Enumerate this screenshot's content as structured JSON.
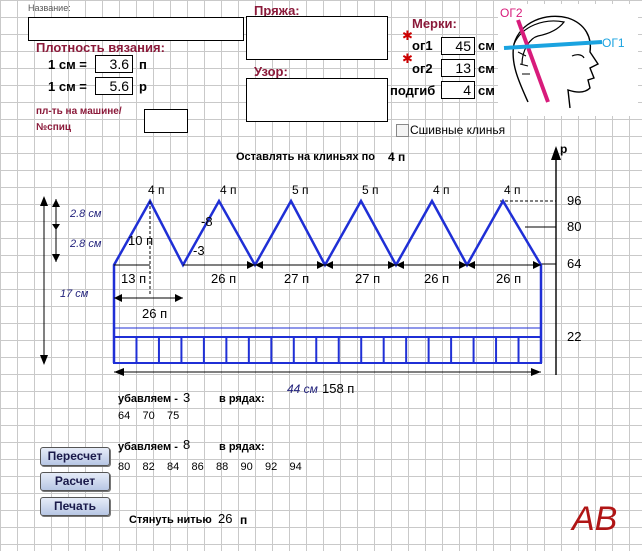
{
  "header": {
    "name_label": "Название:",
    "yarn_label": "Пряжа:",
    "pattern_label": "Узор:",
    "measures_label": "Мерки:"
  },
  "density": {
    "title": "Плотность вязания:",
    "row1_label": "1 см =",
    "row1_value": "3.6",
    "row1_unit": "п",
    "row2_label": "1 см =",
    "row2_value": "5.6",
    "row2_unit": "р",
    "machine_label": "пл-ть на машине/ №спиц"
  },
  "measures": {
    "og1_label": "ог1",
    "og1_value": "45",
    "og1_unit": "см",
    "og2_label": "ог2",
    "og2_value": "13",
    "og2_unit": "см",
    "hem_label": "подгиб",
    "hem_value": "4",
    "hem_unit": "см"
  },
  "head_figure": {
    "og2": "ОГ2",
    "og1": "ОГ1"
  },
  "sewn_wedges": {
    "label": "Сшивные клинья",
    "checked": false
  },
  "leave": {
    "label": "Оставлять на клиньях по",
    "value": "4 п"
  },
  "chart": {
    "top_labels": [
      "4 п",
      "4 п",
      "5 п",
      "5 п",
      "4 п",
      "4 п"
    ],
    "right_labels": [
      "96",
      "80",
      "64",
      "22"
    ],
    "axis_p": "р",
    "left_dims": [
      "2.8 см",
      "2.8 см",
      "17 см"
    ],
    "inner_10": "10 п",
    "minus8": "-8",
    "minus3": "-3",
    "first_13": "13 п",
    "base_26": "26 п",
    "bottom_labels": [
      "26 п",
      "27 п",
      "27 п",
      "26 п",
      "26 п"
    ],
    "total_cm": "44 см",
    "total_p": "158 п",
    "cell_count": 19
  },
  "dec1": {
    "label": "убавляем -",
    "value": "3",
    "rows_label": "в рядах:",
    "rows": [
      "64",
      "70",
      "75"
    ]
  },
  "dec2": {
    "label": "убавляем -",
    "value": "8",
    "rows_label": "в рядах:",
    "rows": [
      "80",
      "82",
      "84",
      "86",
      "88",
      "90",
      "92",
      "94"
    ]
  },
  "buttons": {
    "recalc": "Пересчет",
    "calc": "Расчет",
    "print": "Печать"
  },
  "tighten": {
    "label": "Стянуть нитью",
    "value": "26",
    "unit": "п"
  },
  "logo": "АВ",
  "colors": {
    "accent_red": "#8b1a3a",
    "chart_blue": "#1f2fd6",
    "value_blue": "#1f1f7a"
  }
}
